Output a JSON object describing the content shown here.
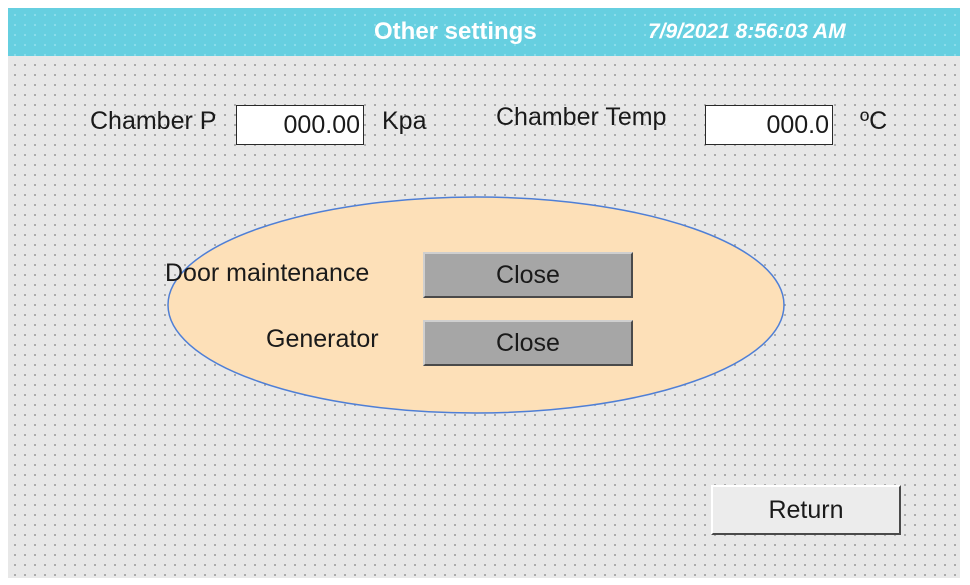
{
  "header": {
    "title": "Other settings",
    "datetime": "7/9/2021 8:56:03 AM"
  },
  "readings": {
    "chamber_p": {
      "label": "Chamber P",
      "value": "000.00",
      "unit": "Kpa"
    },
    "chamber_temp": {
      "label": "Chamber Temp",
      "value": "000.0",
      "unit": "ºC"
    }
  },
  "controls": {
    "door_maintenance": {
      "label": "Door maintenance",
      "button": "Close"
    },
    "generator": {
      "label": "Generator",
      "button": "Close"
    }
  },
  "footer": {
    "return_label": "Return"
  },
  "colors": {
    "titlebar": "#66cfe0",
    "panel_fill": "#fde0b8",
    "panel_border": "#4f7fd6",
    "button_gray": "#a6a6a6",
    "background": "#e8e8e8"
  }
}
